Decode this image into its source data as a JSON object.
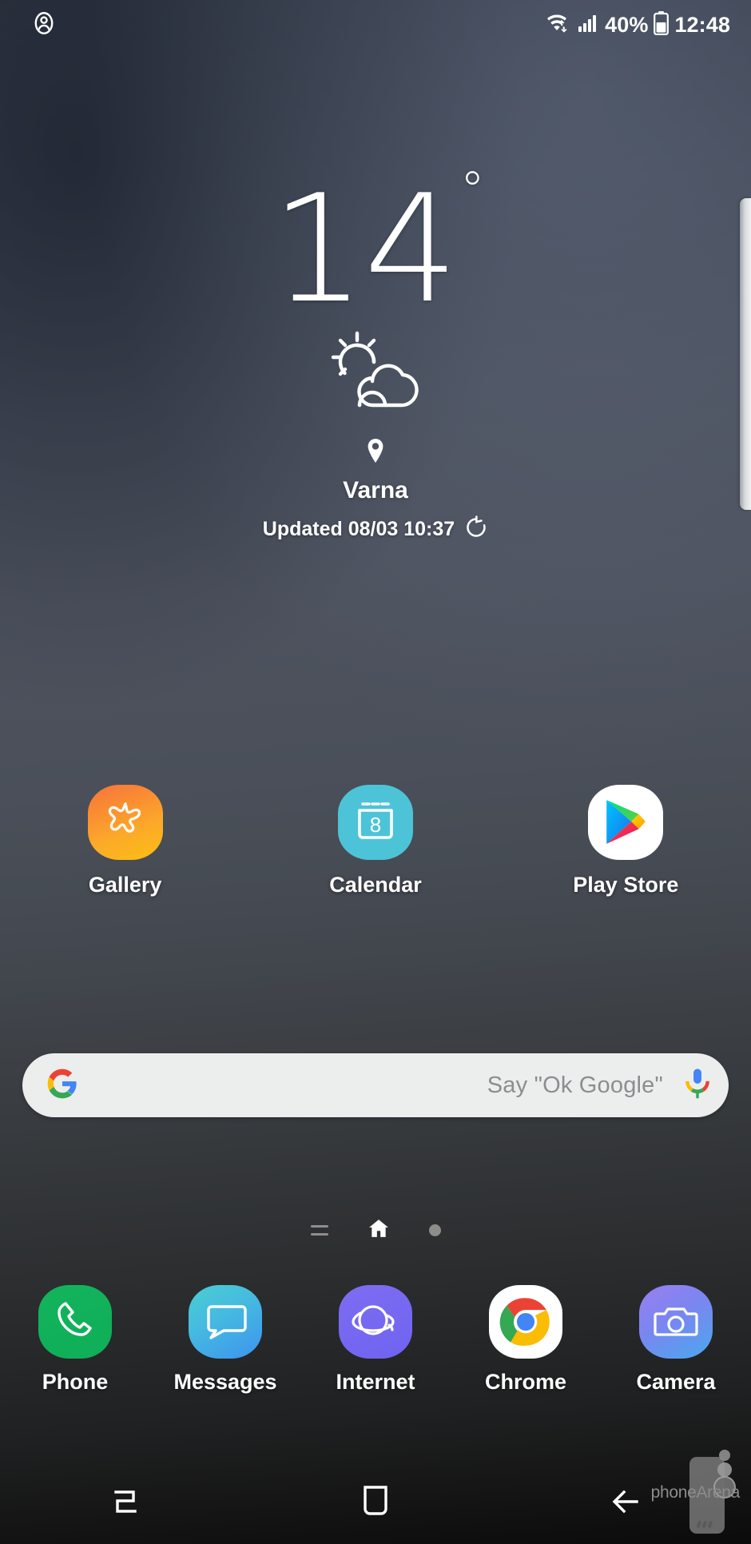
{
  "statusbar": {
    "profile_icon": "account-circle-icon",
    "wifi_icon": "wifi-icon",
    "signal_icon": "cellular-signal-icon",
    "battery_percent": "40%",
    "battery_icon": "battery-icon",
    "clock": "12:48"
  },
  "weather": {
    "temperature": "14",
    "degree_symbol": "°",
    "condition_icon": "partly-cloudy-icon",
    "location_icon": "location-pin-icon",
    "city": "Varna",
    "updated_text": "Updated 08/03 10:37",
    "refresh_icon": "refresh-icon"
  },
  "home_apps": [
    {
      "label": "Gallery",
      "icon": "gallery-icon"
    },
    {
      "label": "Calendar",
      "icon": "calendar-icon",
      "day": "8"
    },
    {
      "label": "Play Store",
      "icon": "play-store-icon"
    }
  ],
  "search": {
    "google_icon": "google-g-icon",
    "placeholder": "Say \"Ok Google\"",
    "mic_icon": "microphone-icon"
  },
  "pager": {
    "bixby_icon": "bixby-page-icon",
    "home_icon": "home-page-icon",
    "dot_icon": "page-dot-icon"
  },
  "dock_apps": [
    {
      "label": "Phone",
      "icon": "phone-icon"
    },
    {
      "label": "Messages",
      "icon": "messages-icon"
    },
    {
      "label": "Internet",
      "icon": "internet-icon"
    },
    {
      "label": "Chrome",
      "icon": "chrome-icon"
    },
    {
      "label": "Camera",
      "icon": "camera-icon"
    }
  ],
  "navbar": {
    "recents_icon": "recents-icon",
    "home_icon": "home-icon",
    "back_icon": "back-icon"
  },
  "watermark": {
    "text": "phoneArena",
    "logo_icon": "phonearena-logo-icon"
  },
  "colors": {
    "accent_teal": "#4dc3d8",
    "accent_green": "#12b45c",
    "accent_orange": "#fa8c32",
    "accent_purple": "#7e6df2",
    "search_bg": "#eceded",
    "text_white": "#ffffff"
  }
}
